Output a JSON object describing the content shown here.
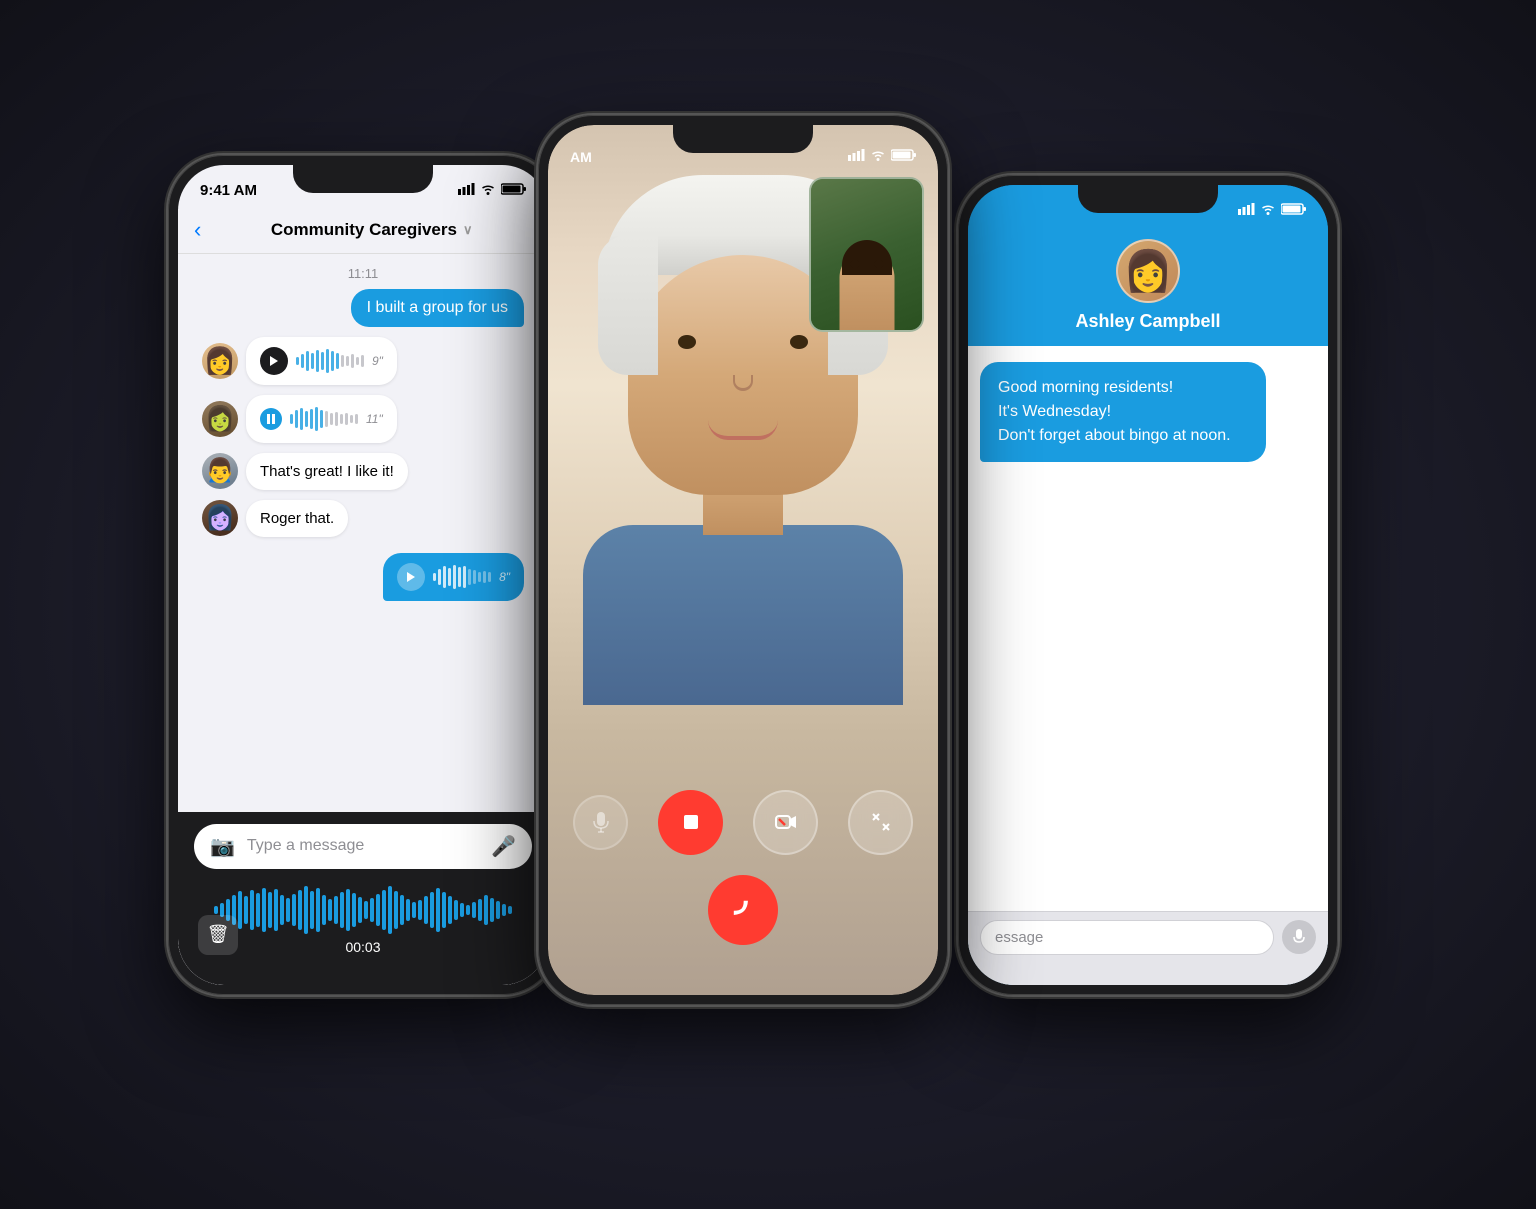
{
  "leftPhone": {
    "statusBar": {
      "time": "9:41 AM",
      "signal": "●●●●",
      "wifi": "WiFi",
      "battery": "Battery"
    },
    "header": {
      "backLabel": "‹",
      "title": "Community Caregivers",
      "chevron": "∨"
    },
    "timestamp": "11:11",
    "messages": [
      {
        "type": "sent-bubble",
        "text": "I built a group for us"
      },
      {
        "type": "voice-received",
        "avatar": "1",
        "duration": "9\""
      },
      {
        "type": "voice-received-playing",
        "avatar": "2",
        "duration": "11\""
      },
      {
        "type": "text-received",
        "avatar": "3",
        "text": "That's great! I like it!"
      },
      {
        "type": "text-received",
        "avatar": "4",
        "text": "Roger that."
      },
      {
        "type": "voice-sent",
        "duration": "8\""
      }
    ],
    "inputPlaceholder": "Type a message",
    "recordingTimer": "00:03"
  },
  "midPhone": {
    "statusBar": {
      "time": "AM",
      "signal": "●●●",
      "wifi": "WiFi",
      "battery": "Battery"
    },
    "controls": {
      "mute": "🎙",
      "stop": "■",
      "camera": "📷",
      "minimize": "⤡",
      "endCall": "📞"
    }
  },
  "rightPhone": {
    "statusBar": {
      "time": "",
      "signal": "●●●",
      "wifi": "WiFi",
      "battery": "Battery"
    },
    "contactName": "Ashley Campbell",
    "message": "Good morning residents!\nIt's Wednesday!\nDon't forget about bingo at noon.",
    "inputPlaceholder": "essage"
  }
}
